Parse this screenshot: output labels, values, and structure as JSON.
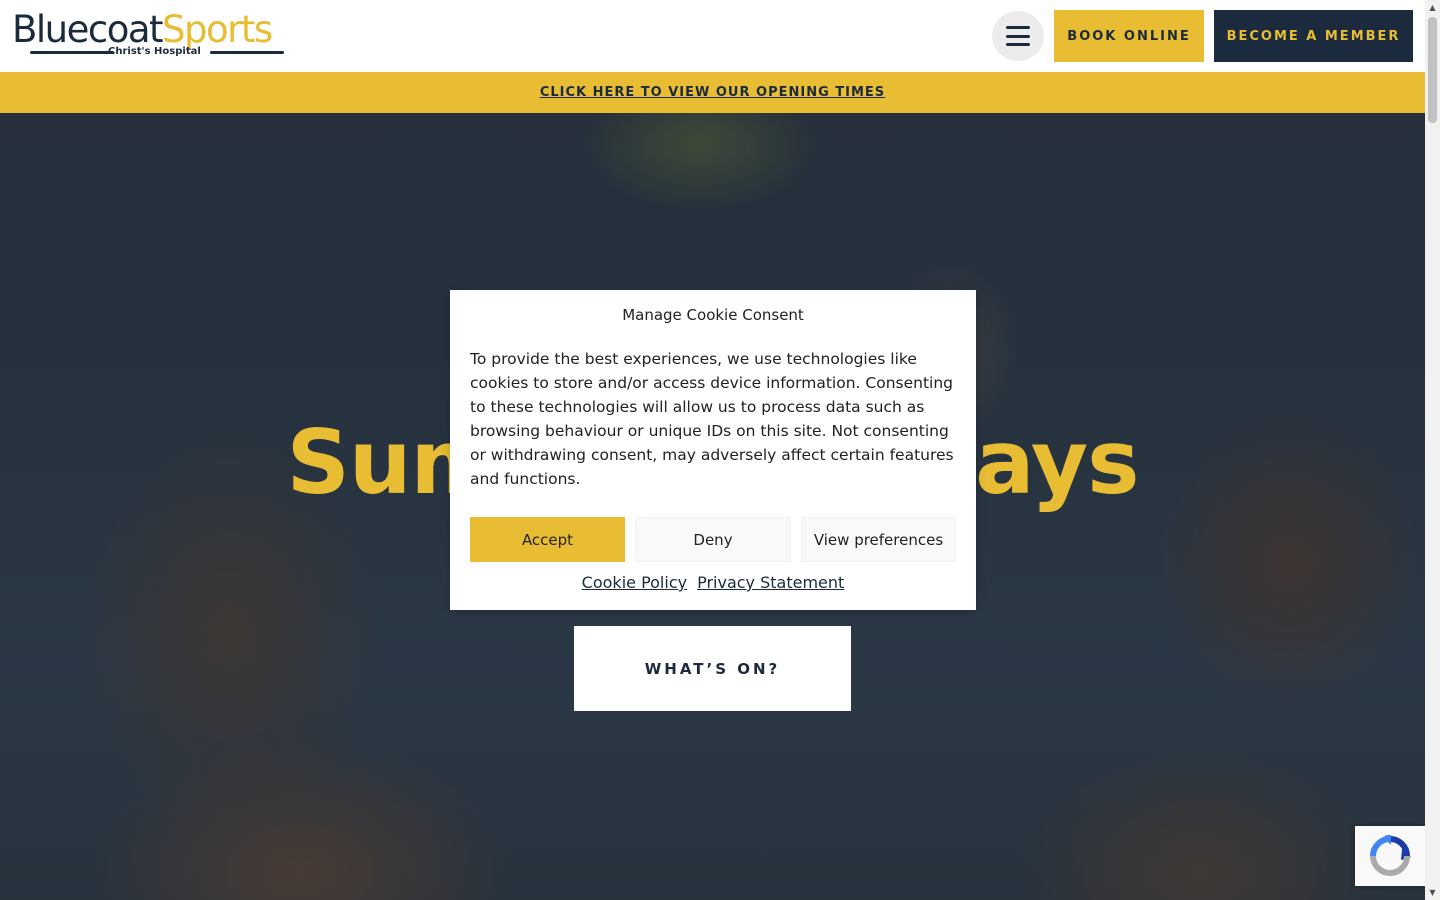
{
  "header": {
    "logo": {
      "brand_part1": "Bluecoat",
      "brand_part2": "Sports",
      "subtitle": "Christ's Hospital"
    },
    "menu_icon": "hamburger-icon",
    "book_online_label": "BOOK ONLINE",
    "become_member_label": "BECOME A MEMBER"
  },
  "notice_bar": {
    "link_text": "CLICK HERE TO VIEW OUR OPENING TIMES"
  },
  "hero": {
    "title": "Summer Holidays",
    "cta_label": "WHAT’S ON?"
  },
  "cookie_modal": {
    "title": "Manage Cookie Consent",
    "body": "To provide the best experiences, we use technologies like cookies to store and/or access device information. Consenting to these technologies will allow us to process data such as browsing behaviour or unique IDs on this site. Not consenting or withdrawing consent, may adversely affect certain features and functions.",
    "accept_label": "Accept",
    "deny_label": "Deny",
    "preferences_label": "View preferences",
    "cookie_policy_label": "Cookie Policy",
    "privacy_statement_label": "Privacy Statement"
  },
  "recaptcha_icon": "recaptcha-icon",
  "colors": {
    "brand_navy": "#1b2a3d",
    "brand_yellow": "#e8bd34",
    "white": "#ffffff"
  }
}
